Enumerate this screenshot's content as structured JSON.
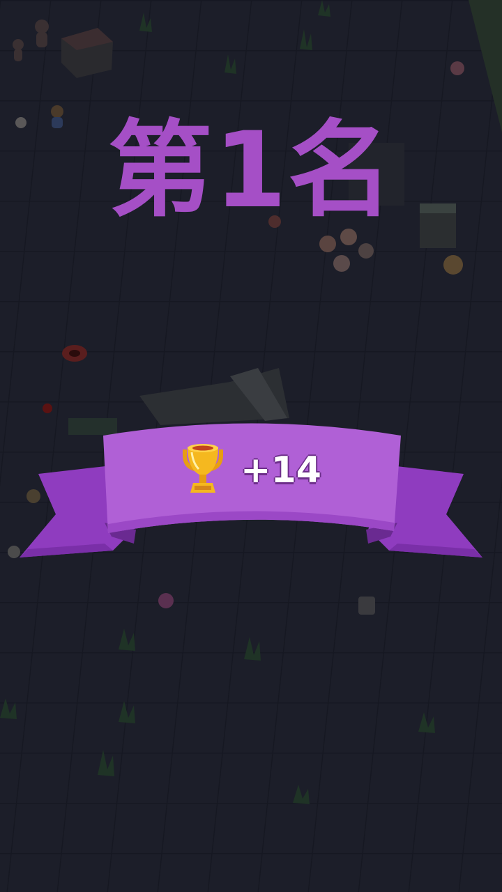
{
  "result": {
    "rank_title": "第1名",
    "reward_value": "+14",
    "reward_icon": "trophy-icon"
  },
  "colors": {
    "background": "#1b1d28",
    "title": "#a54fc6",
    "ribbon_front": "#b060d6",
    "ribbon_back": "#8f3cbf",
    "ribbon_shadow": "#6a2a91",
    "trophy_gold": "#f5b81f"
  }
}
